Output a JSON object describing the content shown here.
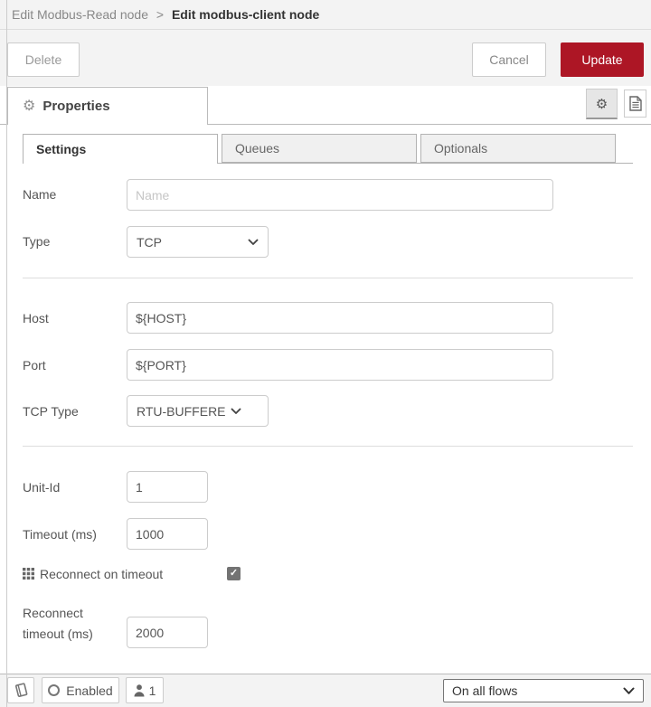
{
  "breadcrumb": {
    "parent": "Edit Modbus-Read node",
    "separator": ">",
    "current": "Edit modbus-client node"
  },
  "toolbar": {
    "delete": "Delete",
    "cancel": "Cancel",
    "update": "Update"
  },
  "panel": {
    "title": "Properties"
  },
  "tabs": [
    {
      "label": "Settings",
      "active": true
    },
    {
      "label": "Queues",
      "active": false
    },
    {
      "label": "Optionals",
      "active": false
    }
  ],
  "form": {
    "name": {
      "label": "Name",
      "placeholder": "Name",
      "value": ""
    },
    "type": {
      "label": "Type",
      "value": "TCP"
    },
    "host": {
      "label": "Host",
      "value": "${HOST}"
    },
    "port": {
      "label": "Port",
      "value": "${PORT}"
    },
    "tcp_type": {
      "label": "TCP Type",
      "value": "RTU-BUFFERED"
    },
    "unit_id": {
      "label": "Unit-Id",
      "value": "1"
    },
    "timeout": {
      "label": "Timeout (ms)",
      "value": "1000"
    },
    "reconnect": {
      "label": "Reconnect on timeout",
      "checked": true
    },
    "reconnect_timeout": {
      "label": "Reconnect timeout (ms)",
      "value": "2000"
    }
  },
  "footer": {
    "enabled": "Enabled",
    "count": "1",
    "scope": "On all flows"
  },
  "colors": {
    "accent_red": "#AD1625",
    "chrome_bg": "#f3f3f3",
    "tab_border": "#b3b3b3"
  }
}
